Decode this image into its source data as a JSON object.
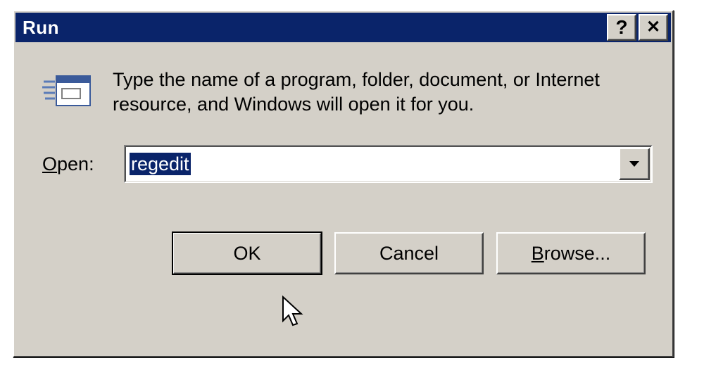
{
  "titlebar": {
    "title": "Run",
    "help_glyph": "?",
    "close_glyph": "✕"
  },
  "body": {
    "description": "Type the name of a program, folder, document, or Internet resource, and Windows will open it for you.",
    "open_label_prefix": "O",
    "open_label_rest": "pen:",
    "input_value": "regedit"
  },
  "buttons": {
    "ok": "OK",
    "cancel": "Cancel",
    "browse_prefix": "B",
    "browse_rest": "rowse..."
  }
}
